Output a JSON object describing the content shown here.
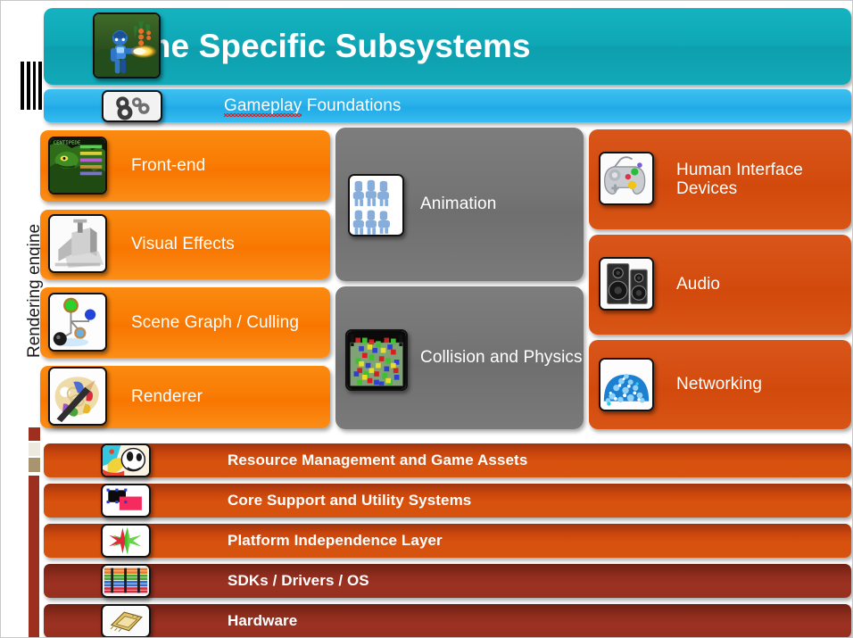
{
  "diagram": {
    "title": "Game Specific Subsystems",
    "side_label": "Rendering engine",
    "gameplay_foundations": {
      "label_misspelled": "Gameplay",
      "label_rest": " Foundations",
      "icon": "gears-icon"
    },
    "title_icon": "game-screenshot-icon"
  },
  "rendering_engine_column": [
    {
      "label": "Front-end",
      "icon": "centipede-game-icon"
    },
    {
      "label": "Visual Effects",
      "icon": "spotlight-icon"
    },
    {
      "label": "Scene Graph / Culling",
      "icon": "scene-graph-icon"
    },
    {
      "label": "Renderer",
      "icon": "paint-palette-icon"
    }
  ],
  "middle_column": [
    {
      "label": "Animation",
      "icon": "animation-sprites-icon"
    },
    {
      "label": "Collision and Physics",
      "icon": "physics-balls-icon"
    }
  ],
  "right_column": [
    {
      "label": "Human Interface\nDevices",
      "icon": "gamepad-icon"
    },
    {
      "label": "Audio",
      "icon": "speakers-icon"
    },
    {
      "label": "Networking",
      "icon": "network-globe-icon"
    }
  ],
  "bottom_layers": [
    {
      "label": "Resource Management and Game Assets",
      "icon": "assets-icon",
      "tone": "orange"
    },
    {
      "label": "Core Support and Utility Systems",
      "icon": "shapes-icon",
      "tone": "orange"
    },
    {
      "label": "Platform Independence Layer",
      "icon": "arrows-icon",
      "tone": "orange"
    },
    {
      "label": "SDKs / Drivers / OS",
      "icon": "layers-icon",
      "tone": "red"
    },
    {
      "label": "Hardware",
      "icon": "cpu-chip-icon",
      "tone": "red"
    }
  ],
  "colors": {
    "title_bar": "#0ea7b6",
    "gameplay_bar": "#28b1ea",
    "rendering_block": "#f87c05",
    "middle_panel": "#747474",
    "right_block": "#d44d10",
    "bottom_orange": "#d2500f",
    "bottom_red": "#962f1e",
    "background": "#ffffff",
    "text": "#ffffff"
  }
}
